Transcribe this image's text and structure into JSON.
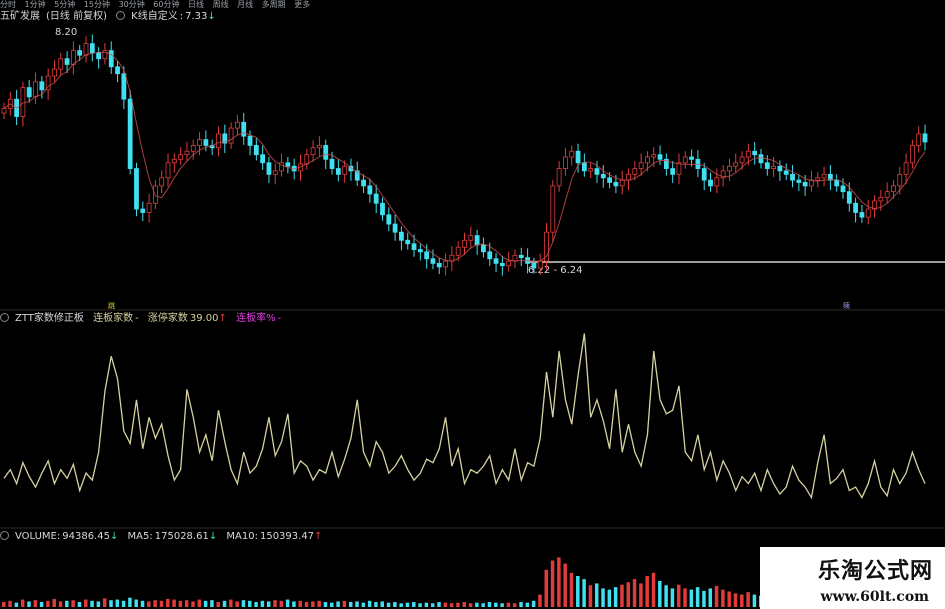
{
  "toolbar": {
    "items": [
      "分时",
      "1分钟",
      "5分钟",
      "15分钟",
      "30分钟",
      "60分钟",
      "日线",
      "周线",
      "月线",
      "多周期",
      "更多"
    ]
  },
  "main_panel": {
    "stock_name": "五矿发展",
    "period": "(日线 前复权)",
    "indicator": "K线自定义",
    "indicator_value": "7.33",
    "arrow": "↓",
    "high_label": "8.20",
    "range_label": "6.22 - 6.24",
    "marker_a": "跳",
    "marker_b": "赎"
  },
  "indicator_panel": {
    "name": "ZTT家数修正板",
    "lianban_label": "连板家数",
    "lianban_value": "-",
    "zhangting_label": "涨停家数",
    "zhangting_value": "39.00",
    "arrow": "↑",
    "lianbanlv_label": "连板率%",
    "lianbanlv_value": "-"
  },
  "volume_panel": {
    "label": "VOLUME:",
    "value": "94386.45",
    "value_arrow": "↓",
    "ma5_label": "MA5:",
    "ma5_value": "175028.61",
    "ma5_arrow": "↓",
    "ma10_label": "MA10:",
    "ma10_value": "150393.47",
    "ma10_arrow": "↑"
  },
  "colors": {
    "up": "#e03c3c",
    "down": "#40e0f0",
    "indicator_line": "#d6d2a0",
    "background": "#000000"
  },
  "watermark": {
    "title": "乐淘公式网",
    "url": "www.60lt.com"
  },
  "chart_data": [
    {
      "type": "candlestick",
      "ylim": [
        6.05,
        8.35
      ],
      "grid": false,
      "close": [
        7.62,
        7.7,
        7.55,
        7.8,
        7.72,
        7.85,
        7.78,
        7.9,
        7.96,
        8.05,
        8.0,
        8.12,
        8.08,
        8.18,
        8.1,
        8.05,
        8.12,
        7.98,
        7.92,
        7.7,
        7.1,
        6.75,
        6.72,
        6.8,
        6.95,
        7.02,
        7.15,
        7.18,
        7.22,
        7.25,
        7.3,
        7.35,
        7.3,
        7.28,
        7.4,
        7.32,
        7.45,
        7.5,
        7.38,
        7.3,
        7.22,
        7.15,
        7.05,
        7.08,
        7.15,
        7.12,
        7.08,
        7.14,
        7.22,
        7.28,
        7.3,
        7.18,
        7.1,
        7.05,
        7.12,
        7.08,
        7.0,
        6.95,
        6.88,
        6.8,
        6.7,
        6.62,
        6.55,
        6.48,
        6.45,
        6.4,
        6.38,
        6.32,
        6.28,
        6.25,
        6.3,
        6.35,
        6.42,
        6.48,
        6.52,
        6.44,
        6.38,
        6.32,
        6.28,
        6.26,
        6.3,
        6.35,
        6.33,
        6.28,
        6.24,
        6.3,
        6.55,
        6.95,
        7.1,
        7.2,
        7.25,
        7.15,
        7.08,
        7.1,
        7.05,
        7.02,
        6.98,
        6.95,
        7.0,
        7.05,
        7.1,
        7.15,
        7.2,
        7.22,
        7.18,
        7.1,
        7.05,
        7.15,
        7.2,
        7.18,
        7.1,
        7.0,
        6.95,
        7.02,
        7.08,
        7.12,
        7.15,
        7.2,
        7.25,
        7.22,
        7.15,
        7.1,
        7.12,
        7.08,
        7.05,
        7.0,
        6.98,
        6.95,
        7.0,
        7.02,
        7.05,
        7.0,
        6.95,
        6.9,
        6.8,
        6.72,
        6.68,
        6.75,
        6.82,
        6.85,
        6.9,
        6.95,
        7.05,
        7.15,
        7.3,
        7.4,
        7.33
      ]
    },
    {
      "type": "line",
      "series": [
        {
          "name": "涨停家数",
          "values": [
            25,
            30,
            22,
            34,
            26,
            20,
            28,
            35,
            22,
            30,
            25,
            33,
            18,
            28,
            24,
            40,
            75,
            95,
            82,
            52,
            45,
            70,
            42,
            60,
            48,
            56,
            38,
            24,
            30,
            76,
            60,
            40,
            50,
            35,
            64,
            46,
            30,
            22,
            40,
            28,
            32,
            42,
            60,
            38,
            46,
            62,
            28,
            35,
            32,
            24,
            30,
            28,
            40,
            26,
            36,
            48,
            70,
            40,
            32,
            46,
            40,
            28,
            32,
            38,
            30,
            24,
            28,
            36,
            34,
            42,
            60,
            32,
            42,
            22,
            30,
            28,
            32,
            38,
            22,
            30,
            24,
            42,
            24,
            34,
            32,
            48,
            86,
            60,
            98,
            70,
            56,
            84,
            108,
            60,
            70,
            58,
            42,
            76,
            40,
            56,
            40,
            32,
            50,
            98,
            70,
            62,
            64,
            78,
            40,
            35,
            50,
            30,
            40,
            24,
            35,
            28,
            18,
            26,
            22,
            28,
            18,
            30,
            22,
            16,
            20,
            32,
            24,
            20,
            14,
            34,
            50,
            22,
            25,
            30,
            18,
            20,
            14,
            22,
            35,
            20,
            15,
            30,
            22,
            28,
            40,
            30,
            22
          ]
        }
      ]
    },
    {
      "type": "bar",
      "series": [
        {
          "name": "VOLUME",
          "values": [
            0.08,
            0.1,
            0.07,
            0.12,
            0.09,
            0.11,
            0.08,
            0.1,
            0.13,
            0.09,
            0.1,
            0.11,
            0.08,
            0.12,
            0.1,
            0.09,
            0.14,
            0.11,
            0.12,
            0.1,
            0.15,
            0.12,
            0.1,
            0.09,
            0.11,
            0.1,
            0.13,
            0.12,
            0.1,
            0.11,
            0.09,
            0.12,
            0.1,
            0.11,
            0.08,
            0.1,
            0.12,
            0.09,
            0.11,
            0.1,
            0.08,
            0.1,
            0.09,
            0.11,
            0.1,
            0.12,
            0.09,
            0.1,
            0.08,
            0.09,
            0.1,
            0.08,
            0.07,
            0.09,
            0.1,
            0.08,
            0.09,
            0.07,
            0.1,
            0.08,
            0.09,
            0.07,
            0.08,
            0.06,
            0.07,
            0.08,
            0.06,
            0.07,
            0.06,
            0.08,
            0.07,
            0.06,
            0.07,
            0.08,
            0.06,
            0.07,
            0.06,
            0.08,
            0.07,
            0.06,
            0.07,
            0.06,
            0.08,
            0.07,
            0.1,
            0.2,
            0.6,
            0.75,
            0.8,
            0.7,
            0.55,
            0.5,
            0.45,
            0.35,
            0.38,
            0.3,
            0.28,
            0.32,
            0.36,
            0.4,
            0.45,
            0.38,
            0.5,
            0.55,
            0.42,
            0.35,
            0.3,
            0.36,
            0.3,
            0.28,
            0.32,
            0.26,
            0.3,
            0.34,
            0.28,
            0.25,
            0.22,
            0.2,
            0.24,
            0.2,
            0.18,
            0.22,
            0.2,
            0.18,
            0.16,
            0.15,
            0.18,
            0.15,
            0.14,
            0.13,
            0.12,
            0.15,
            0.14,
            0.16,
            0.15,
            0.18,
            0.2,
            0.22,
            0.25,
            0.22,
            0.2,
            0.2,
            0.18,
            0.2,
            0.22,
            0.2,
            0.18
          ]
        }
      ]
    }
  ]
}
